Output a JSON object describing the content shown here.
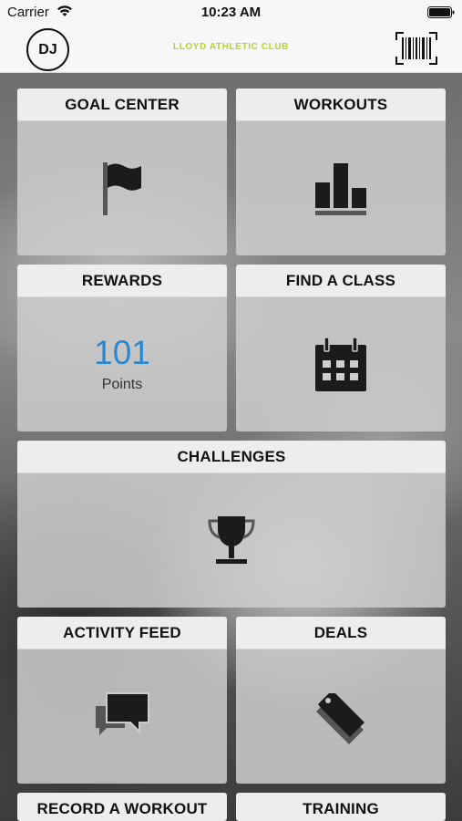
{
  "status_bar": {
    "carrier": "Carrier",
    "time": "10:23 AM"
  },
  "header": {
    "avatar_initials": "DJ",
    "club_name": "LLOYD ATHLETIC CLUB",
    "accent_color": "#b5d334"
  },
  "tiles": {
    "goal_center": {
      "label": "GOAL CENTER",
      "icon": "flag-icon"
    },
    "workouts": {
      "label": "WORKOUTS",
      "icon": "bar-chart-icon"
    },
    "rewards": {
      "label": "REWARDS",
      "points_value": "101",
      "points_label": "Points"
    },
    "find_a_class": {
      "label": "FIND A CLASS",
      "icon": "calendar-icon"
    },
    "challenges": {
      "label": "CHALLENGES",
      "icon": "trophy-icon"
    },
    "activity_feed": {
      "label": "ACTIVITY FEED",
      "icon": "chat-bubbles-icon"
    },
    "deals": {
      "label": "DEALS",
      "icon": "tag-icon"
    },
    "record_a_workout": {
      "label": "RECORD A WORKOUT"
    },
    "training": {
      "label": "TRAINING"
    }
  },
  "colors": {
    "points_blue": "#2b87cd",
    "tile_header": "#ededed"
  }
}
